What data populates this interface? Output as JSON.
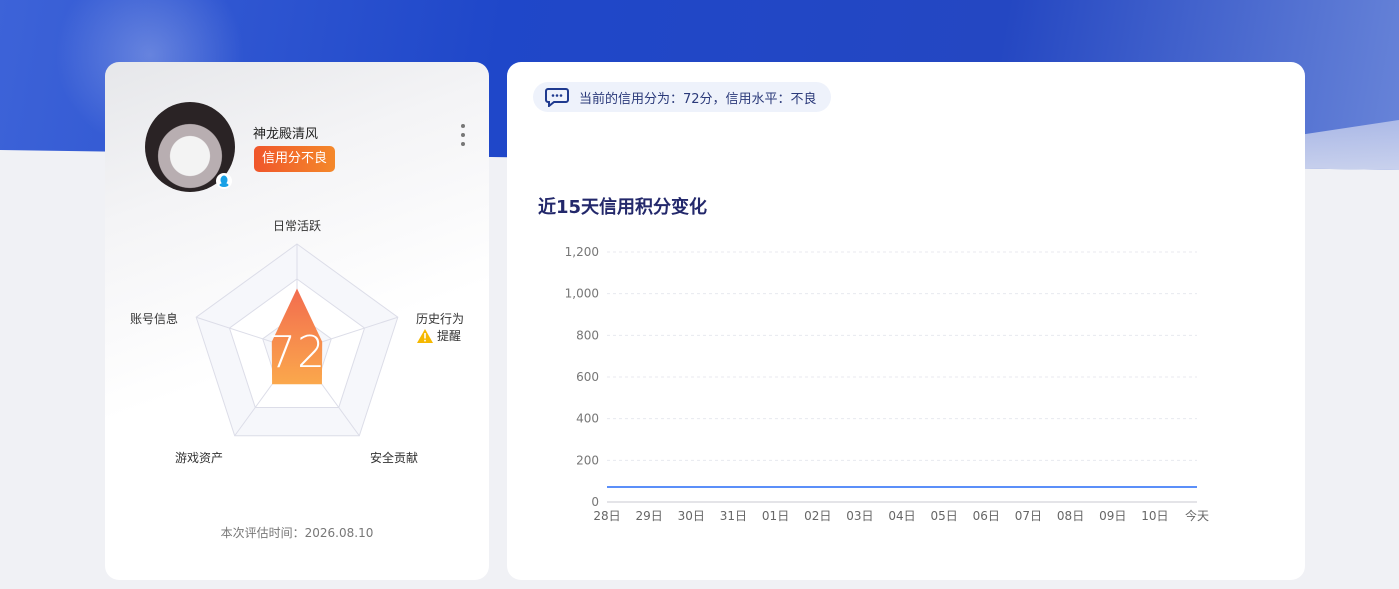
{
  "profile": {
    "username": "神龙殿清风",
    "badge": "信用分不良",
    "score": "72",
    "eval_label": "本次评估时间：",
    "eval_date": "2026.08.10"
  },
  "radar": {
    "labels": [
      "日常活跃",
      "历史行为",
      "安全贡献",
      "游戏资产",
      "账号信息"
    ],
    "warning_text": "提醒",
    "values": [
      0.58,
      0.25,
      0.4,
      0.4,
      0.25
    ],
    "fill_top": "#f26c4f",
    "fill_bottom": "#fba84c"
  },
  "notice": {
    "text": "当前的信用分为：72分，信用水平：不良"
  },
  "chart_data": {
    "type": "line",
    "title": "近15天信用积分变化",
    "categories": [
      "28日",
      "29日",
      "30日",
      "31日",
      "01日",
      "02日",
      "03日",
      "04日",
      "05日",
      "06日",
      "07日",
      "08日",
      "09日",
      "10日",
      "今天"
    ],
    "series": [
      {
        "values": [
          72,
          72,
          72,
          72,
          72,
          72,
          72,
          72,
          72,
          72,
          72,
          72,
          72,
          72,
          72
        ]
      }
    ],
    "yticks": [
      "0",
      "200",
      "400",
      "600",
      "800",
      "1,000",
      "1,200"
    ],
    "ylim": [
      0,
      1200
    ],
    "grid": true,
    "line_color": "#5b8ff9"
  }
}
